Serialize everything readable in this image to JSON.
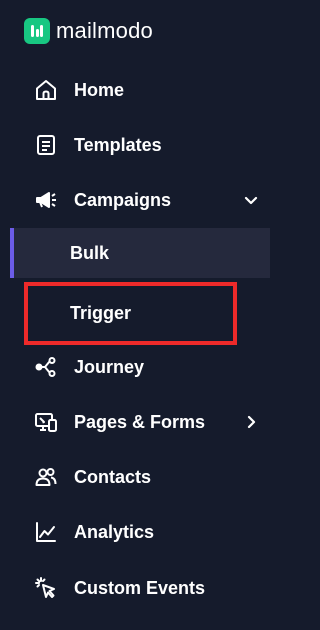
{
  "brand": {
    "name": "mailmodo",
    "logo_color": "#18c782"
  },
  "nav": {
    "items": [
      {
        "label": "Home",
        "icon": "home-icon"
      },
      {
        "label": "Templates",
        "icon": "template-icon"
      },
      {
        "label": "Campaigns",
        "icon": "megaphone-icon",
        "expanded": true,
        "children": [
          {
            "label": "Bulk",
            "active": true
          },
          {
            "label": "Trigger",
            "active": false,
            "highlighted": true
          }
        ]
      },
      {
        "label": "Journey",
        "icon": "journey-icon"
      },
      {
        "label": "Pages & Forms",
        "icon": "pages-forms-icon",
        "has_submenu": true
      },
      {
        "label": "Contacts",
        "icon": "contacts-icon"
      },
      {
        "label": "Analytics",
        "icon": "analytics-icon"
      },
      {
        "label": "Custom Events",
        "icon": "custom-events-icon"
      }
    ]
  },
  "colors": {
    "background": "#151b2c",
    "active_background": "#25293d",
    "active_indicator": "#6c5ce7",
    "highlight_border": "#ee2a2a",
    "text": "#ffffff"
  }
}
